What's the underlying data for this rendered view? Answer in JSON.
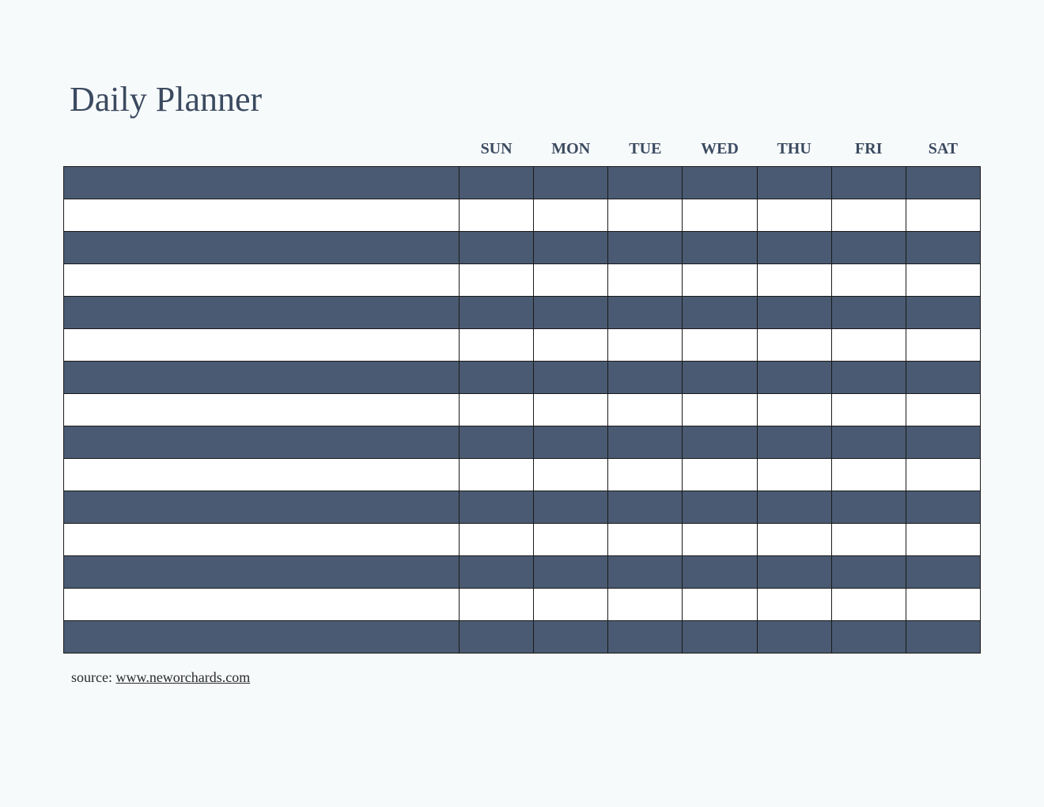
{
  "title": "Daily Planner",
  "days": [
    "SUN",
    "MON",
    "TUE",
    "WED",
    "THU",
    "FRI",
    "SAT"
  ],
  "row_count": 15,
  "source": {
    "label": "source: ",
    "link_text": "www.neworchards.com"
  },
  "colors": {
    "dark_row": "#4a5a72",
    "light_row": "#ffffff",
    "text": "#3b4a60",
    "border": "#1a1a1a",
    "background": "#f7fafb"
  }
}
